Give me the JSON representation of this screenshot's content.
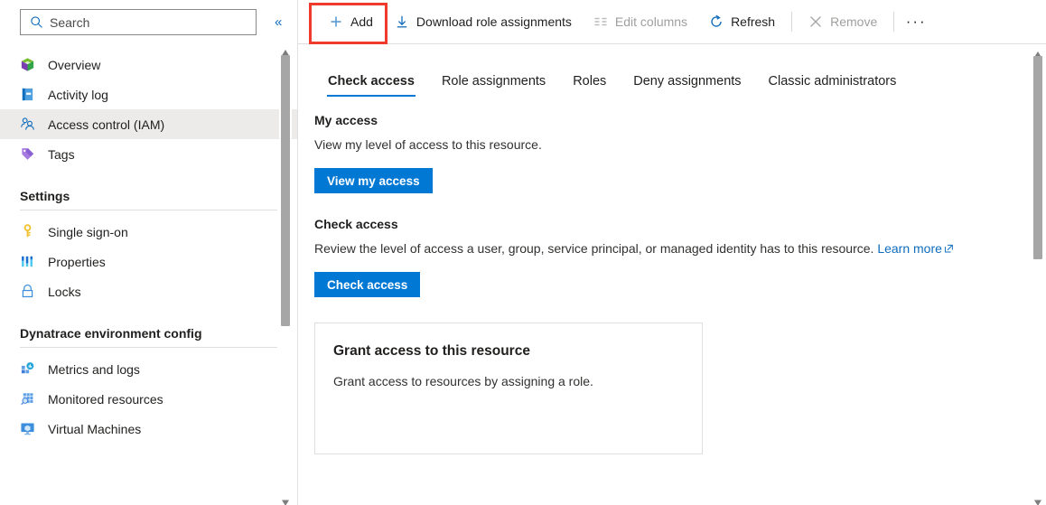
{
  "sidebar": {
    "search": {
      "placeholder": "Search",
      "icon": "search-icon"
    },
    "collapse_label": "«",
    "items": [
      {
        "label": "Overview",
        "icon": "overview-cube-icon",
        "active": false
      },
      {
        "label": "Activity log",
        "icon": "activity-log-book-icon",
        "active": false
      },
      {
        "label": "Access control (IAM)",
        "icon": "access-control-people-icon",
        "active": true
      },
      {
        "label": "Tags",
        "icon": "tag-icon",
        "active": false
      }
    ],
    "groups": [
      {
        "title": "Settings",
        "items": [
          {
            "label": "Single sign-on",
            "icon": "key-icon"
          },
          {
            "label": "Properties",
            "icon": "properties-bars-icon"
          },
          {
            "label": "Locks",
            "icon": "lock-icon"
          }
        ]
      },
      {
        "title": "Dynatrace environment config",
        "items": [
          {
            "label": "Metrics and logs",
            "icon": "metrics-logs-icon"
          },
          {
            "label": "Monitored resources",
            "icon": "monitored-resources-icon"
          },
          {
            "label": "Virtual Machines",
            "icon": "virtual-machine-icon"
          }
        ]
      }
    ]
  },
  "toolbar": {
    "add_label": "Add",
    "download_label": "Download role assignments",
    "edit_columns_label": "Edit columns",
    "refresh_label": "Refresh",
    "remove_label": "Remove",
    "more_label": "···",
    "highlight_color": "#f03a2e"
  },
  "tabs": [
    {
      "label": "Check access",
      "active": true
    },
    {
      "label": "Role assignments",
      "active": false
    },
    {
      "label": "Roles",
      "active": false
    },
    {
      "label": "Deny assignments",
      "active": false
    },
    {
      "label": "Classic administrators",
      "active": false
    }
  ],
  "main": {
    "my_access": {
      "title": "My access",
      "description": "View my level of access to this resource.",
      "button": "View my access"
    },
    "check_access": {
      "title": "Check access",
      "description": "Review the level of access a user, group, service principal, or managed identity has to this resource.",
      "link": "Learn more",
      "button": "Check access"
    },
    "grant_card": {
      "title": "Grant access to this resource",
      "description": "Grant access to resources by assigning a role."
    }
  },
  "colors": {
    "accent": "#0078d4",
    "link": "#0f6cbd",
    "active_nav_bg": "#edebe9",
    "highlight": "#f03a2e"
  }
}
